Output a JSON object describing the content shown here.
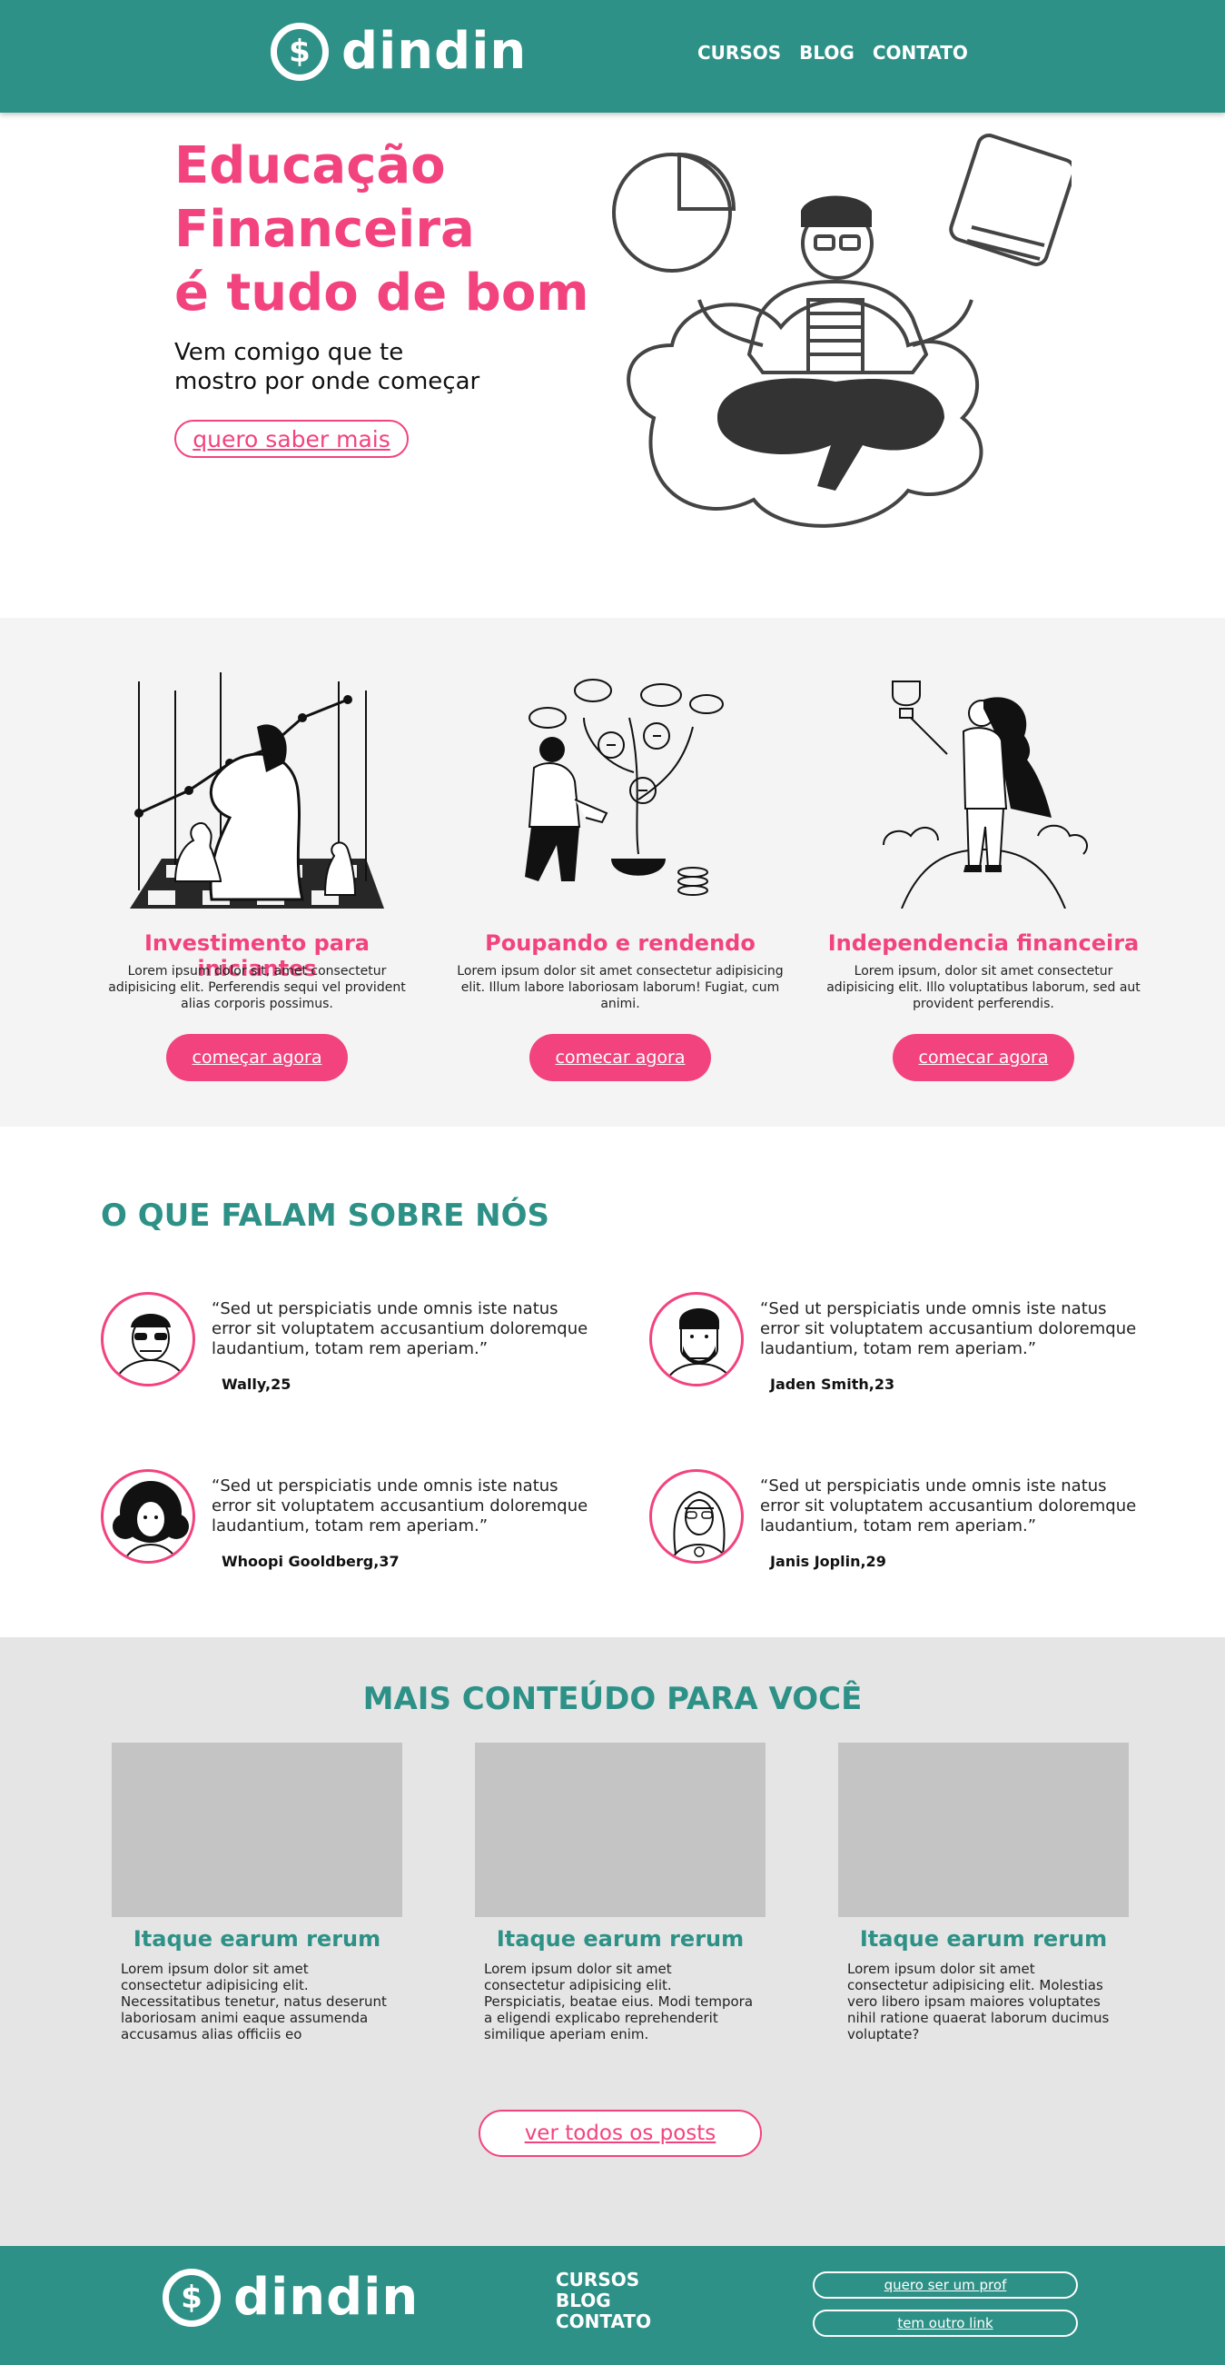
{
  "header": {
    "brand": "dindin",
    "logo_icon": "dollar-bubble-icon",
    "nav": [
      "CURSOS",
      "BLOG",
      "CONTATO"
    ]
  },
  "hero": {
    "title_line1": "Educação",
    "title_line2": "Financeira",
    "title_line3": "é tudo de bom",
    "subtitle_line1": "Vem comigo que te",
    "subtitle_line2": "mostro por onde começar",
    "cta": "quero saber mais"
  },
  "features": [
    {
      "title": "Investimento para iniciantes",
      "desc": "Lorem ipsum dolor sit, amet consectetur adipisicing elit. Perferendis sequi vel provident alias corporis possimus.",
      "button": "começar agora",
      "icon": "chess-knight-icon"
    },
    {
      "title": "Poupando e rendendo",
      "desc": "Lorem ipsum dolor sit amet consectetur adipisicing elit. Illum labore laboriosam laborum! Fugiat, cum animi.",
      "button": "comecar agora",
      "icon": "money-tree-icon"
    },
    {
      "title": "Independencia financeira",
      "desc": "Lorem ipsum, dolor sit amet consectetur adipisicing elit. Illo voluptatibus laborum, sed aut provident perferendis.",
      "button": "comecar agora",
      "icon": "trophy-hero-icon"
    }
  ],
  "testimonials": {
    "title": "O QUE FALAM SOBRE NÓS",
    "items": [
      {
        "quote": "“Sed ut perspiciatis unde omnis iste natus error sit voluptatem accusantium doloremque laudantium, totam rem aperiam.”",
        "name": "Wally,25",
        "avatar": "avatar-cap-sunglasses-icon"
      },
      {
        "quote": "“Sed ut perspiciatis unde omnis iste natus error sit voluptatem accusantium doloremque laudantium, totam rem aperiam.”",
        "name": "Jaden Smith,23",
        "avatar": "avatar-beard-icon"
      },
      {
        "quote": "“Sed ut perspiciatis unde omnis iste natus error sit voluptatem accusantium doloremque laudantium, totam rem aperiam.”",
        "name": "Whoopi Gooldberg,37",
        "avatar": "avatar-curly-hair-icon"
      },
      {
        "quote": "“Sed ut perspiciatis unde omnis iste natus error sit voluptatem accusantium doloremque laudantium, totam rem aperiam.”",
        "name": "Janis Joplin,29",
        "avatar": "avatar-long-hair-icon"
      }
    ]
  },
  "more": {
    "title": "MAIS CONTEÚDO PARA VOCÊ",
    "posts": [
      {
        "title": "Itaque earum rerum",
        "desc": "Lorem ipsum dolor sit amet consectetur adipisicing elit. Necessitatibus tenetur, natus deserunt laboriosam animi eaque assumenda accusamus alias officiis eo"
      },
      {
        "title": "Itaque earum rerum",
        "desc": "Lorem ipsum dolor sit amet consectetur adipisicing elit. Perspiciatis, beatae eius. Modi tempora a eligendi explicabo reprehenderit similique aperiam enim."
      },
      {
        "title": "Itaque earum rerum",
        "desc": "Lorem ipsum dolor sit amet consectetur adipisicing elit. Molestias vero libero ipsam maiores voluptates nihil ratione quaerat laborum ducimus voluptate?"
      }
    ],
    "button": "ver todos os posts"
  },
  "footer": {
    "brand": "dindin",
    "nav": [
      "CURSOS",
      "BLOG",
      "CONTATO"
    ],
    "btn1": "quero ser um prof",
    "btn2": "tem outro link"
  },
  "colors": {
    "teal": "#2E9187",
    "pink": "#F2437F",
    "light_bg": "#F4F4F4",
    "grey_bg": "#E5E5E5",
    "placeholder": "#C4C4C4"
  }
}
